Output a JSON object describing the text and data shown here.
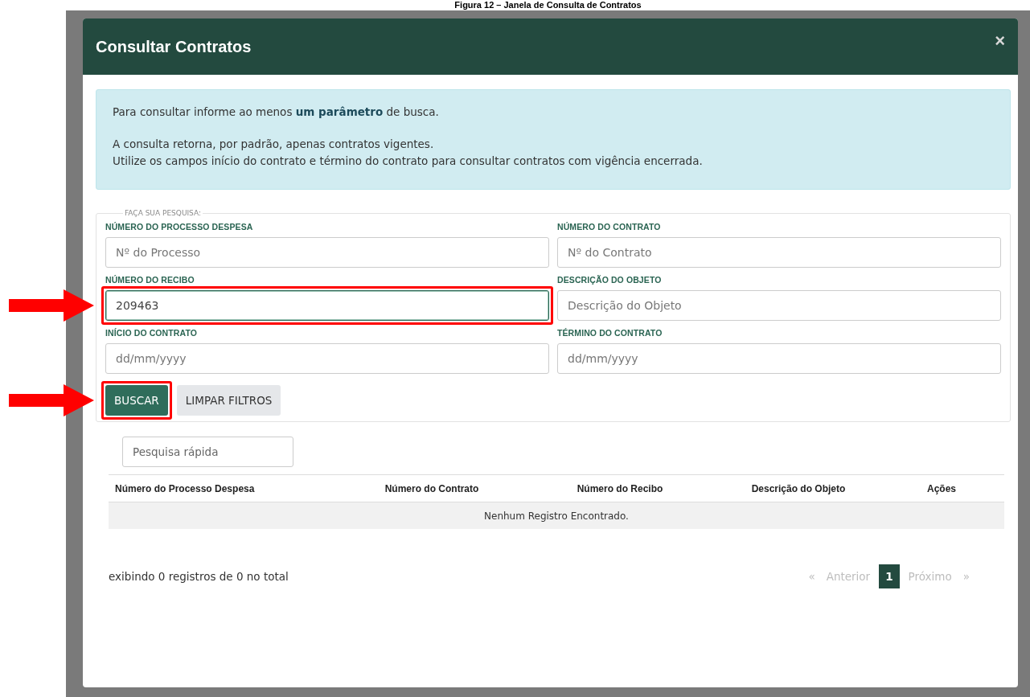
{
  "caption": "Figura 12 – Janela de Consulta de Contratos",
  "modal": {
    "title": "Consultar Contratos",
    "close": "×"
  },
  "alert": {
    "lines": [
      "Para consultar informe ao menos **um parâmetro** de busca.",
      "A consulta retorna, por padrão, apenas contratos vigentes.",
      "Utilize os campos início do contrato e término do contrato para consultar contratos com vigência encerrada."
    ]
  },
  "search_form": {
    "legend": "FAÇA SUA PESQUISA:",
    "fields": [
      {
        "label": "NÚMERO DO PROCESSO DESPESA",
        "placeholder": "Nº do Processo",
        "highlighted": false
      },
      {
        "label": "NÚMERO DO CONTRATO",
        "placeholder": "Nº do Contrato",
        "highlighted": false
      },
      {
        "label": "NÚMERO DO RECIBO",
        "value": "209463",
        "highlighted": true
      },
      {
        "label": "DESCRIÇÃO DO OBJETO",
        "placeholder": "Descrição do Objeto",
        "highlighted": false
      },
      {
        "label": "INÍCIO DO CONTRATO",
        "placeholder": "dd/mm/yyyy",
        "highlighted": false
      },
      {
        "label": "TÉRMINO DO CONTRATO",
        "placeholder": "dd/mm/yyyy",
        "highlighted": false
      }
    ],
    "buttons": [
      {
        "label": "BUSCAR",
        "kind": "primary",
        "highlighted": true
      },
      {
        "label": "LIMPAR FILTROS",
        "kind": "secondary",
        "highlighted": false
      }
    ]
  },
  "quick_search": {
    "placeholder": "Pesquisa rápida"
  },
  "table": {
    "columns": [
      "Número do Processo Despesa",
      "Número do Contrato",
      "Número do Recibo",
      "Descrição do Objeto",
      "Ações"
    ],
    "empty_message": "Nenhum Registro Encontrado."
  },
  "footer": {
    "info": "exibindo 0 registros de 0 no total",
    "pagination": [
      {
        "label": "«",
        "kind": "nav",
        "selected": false
      },
      {
        "label": "Anterior",
        "kind": "nav",
        "selected": false
      },
      {
        "label": "1",
        "kind": "page",
        "selected": true
      },
      {
        "label": "Próximo",
        "kind": "nav",
        "selected": false
      },
      {
        "label": "»",
        "kind": "nav",
        "selected": false
      }
    ]
  }
}
